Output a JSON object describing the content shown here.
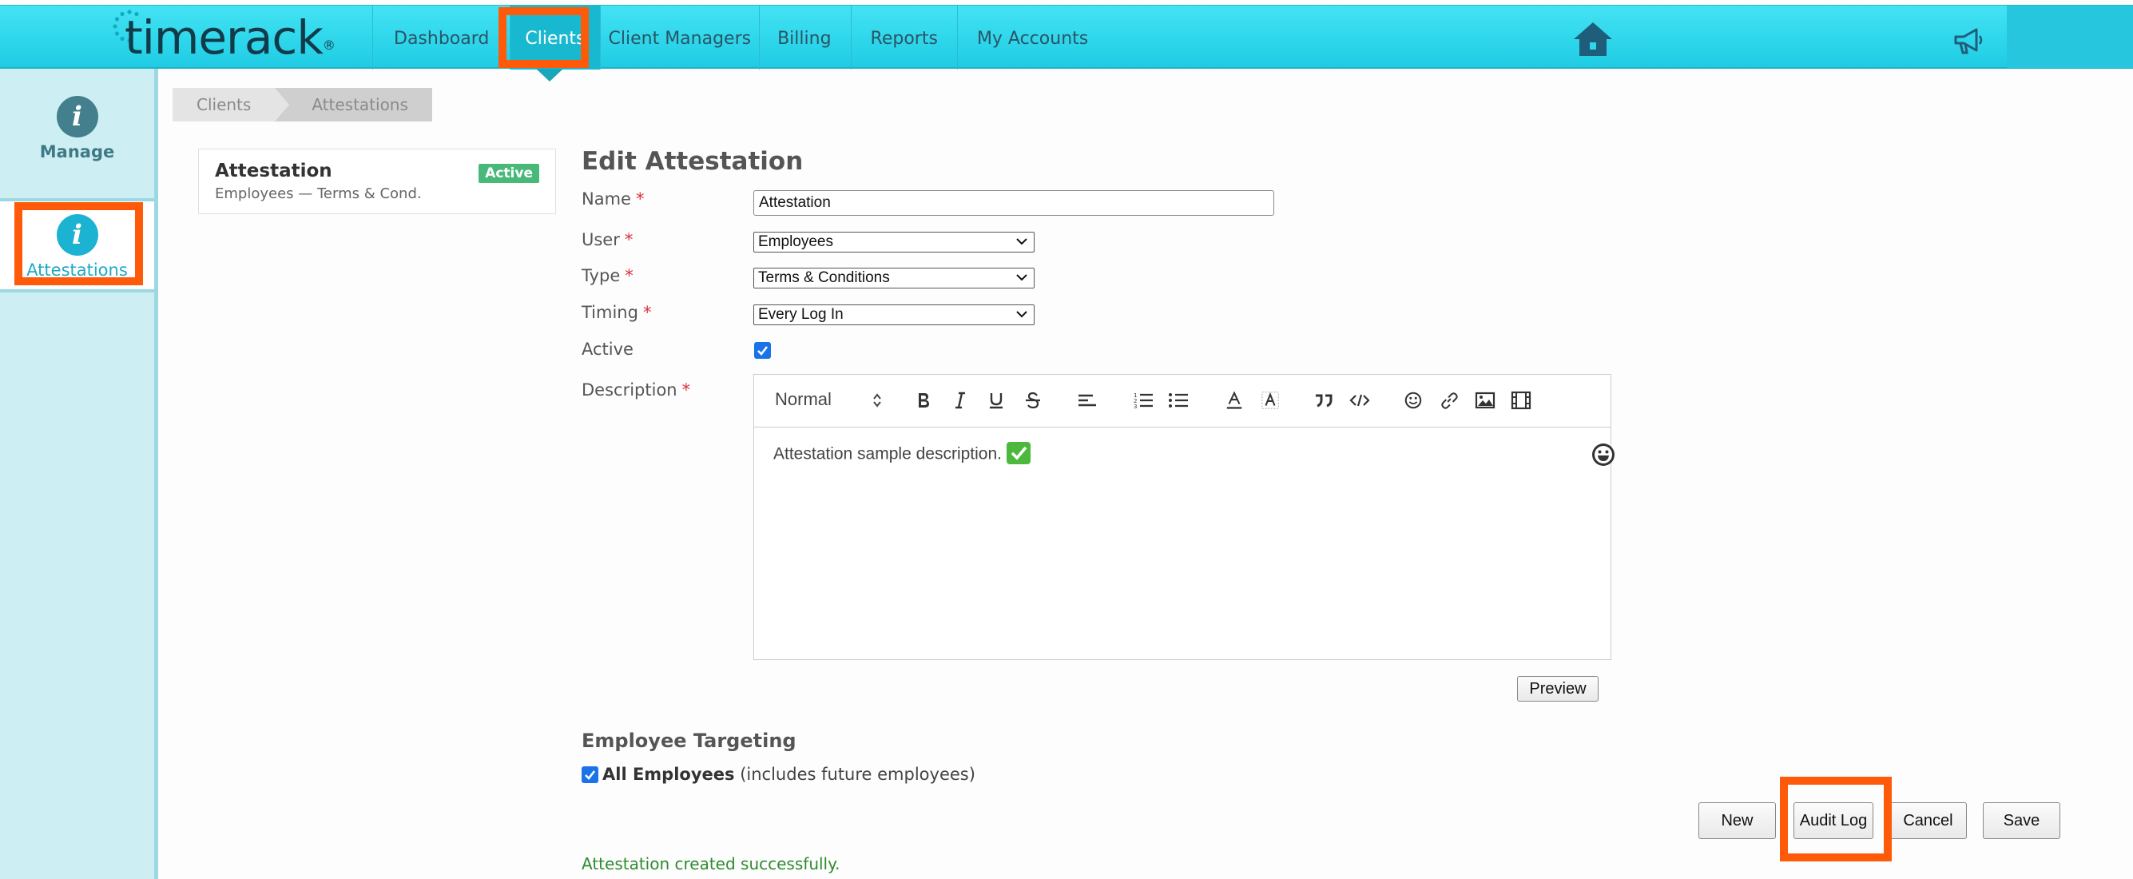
{
  "brand": {
    "name": "timerack",
    "reg": "®"
  },
  "nav": {
    "items": [
      {
        "label": "Dashboard"
      },
      {
        "label": "Clients"
      },
      {
        "label": "Client Managers"
      },
      {
        "label": "Billing"
      },
      {
        "label": "Reports"
      },
      {
        "label": "My Accounts"
      }
    ],
    "active_index": 1
  },
  "sidebar": {
    "items": [
      {
        "label": "Manage",
        "icon": "info-icon"
      },
      {
        "label": "Attestations",
        "icon": "info-icon"
      }
    ],
    "selected_index": 1
  },
  "breadcrumb": [
    "Clients",
    "Attestations"
  ],
  "list": {
    "items": [
      {
        "title": "Attestation",
        "subtitle": "Employees — Terms & Cond.",
        "badge": "Active"
      }
    ]
  },
  "form": {
    "title": "Edit Attestation",
    "name": {
      "label": "Name",
      "value": "Attestation",
      "required": "*"
    },
    "user": {
      "label": "User",
      "value": "Employees",
      "required": "*"
    },
    "type": {
      "label": "Type",
      "value": "Terms & Conditions",
      "required": "*"
    },
    "timing": {
      "label": "Timing",
      "value": "Every Log In",
      "required": "*"
    },
    "active": {
      "label": "Active",
      "checked": true
    },
    "description": {
      "label": "Description",
      "required": "*",
      "format": "Normal",
      "text": "Attestation sample description."
    },
    "preview_label": "Preview"
  },
  "targeting": {
    "title": "Employee Targeting",
    "all_label": "All Employees",
    "all_note": "(includes future employees)",
    "checked": true
  },
  "actions": {
    "new": "New",
    "audit_log": "Audit Log",
    "cancel": "Cancel",
    "save": "Save"
  },
  "status": {
    "message": "Attestation created successfully."
  },
  "colors": {
    "topbar": "#2dd6ea",
    "highlight": "#ff5a0a",
    "success": "#2e8b2e",
    "badge": "#49b97a"
  }
}
